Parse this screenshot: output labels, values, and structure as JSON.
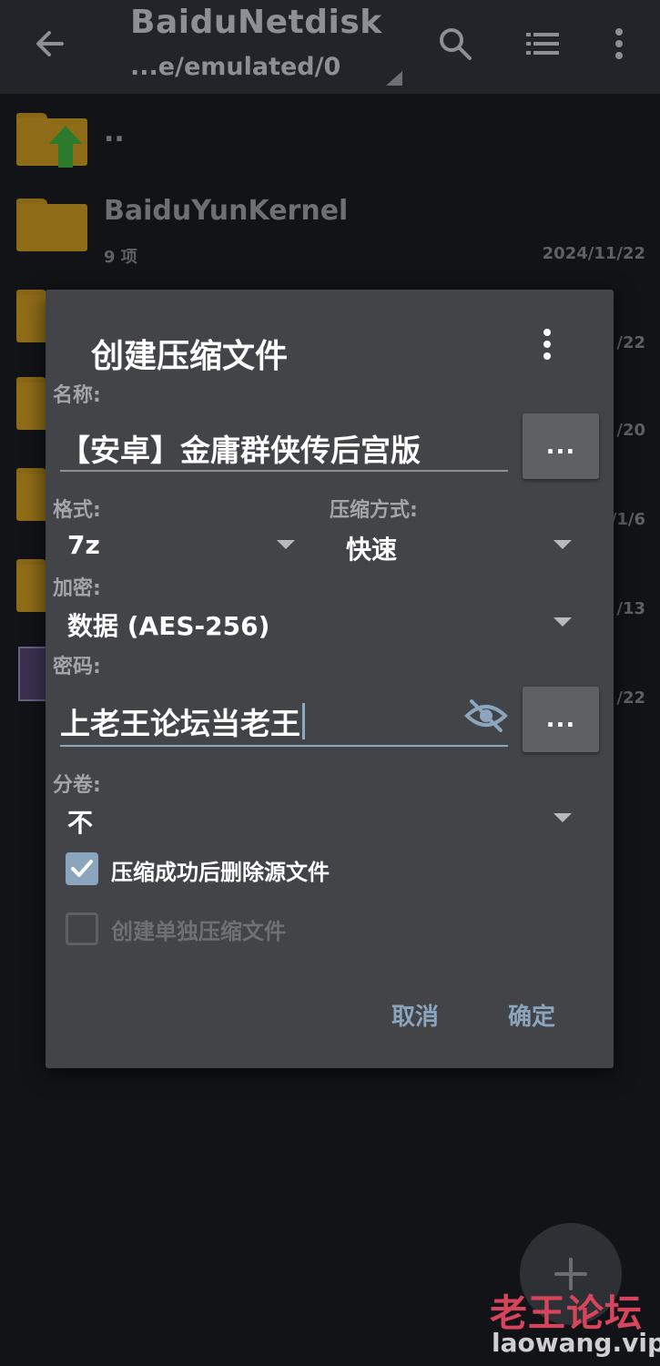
{
  "topbar": {
    "title": "BaiduNetdisk",
    "subtitle": "...e/emulated/0"
  },
  "files": [
    {
      "name": "..",
      "meta": "",
      "date": ""
    },
    {
      "name": "BaiduYunKernel",
      "meta": "9 项",
      "date": "2024/11/22"
    },
    {
      "date": "/22"
    },
    {
      "date": "/20"
    },
    {
      "date": "/1/6"
    },
    {
      "date": "/13"
    },
    {
      "date": "/22"
    }
  ],
  "dialog": {
    "title": "创建压缩文件",
    "name_label": "名称:",
    "name_value": "【安卓】金庸群侠传后宫版",
    "browse_label": "...",
    "format_label": "格式:",
    "format_value": "7z",
    "method_label": "压缩方式:",
    "method_value": "快速",
    "encrypt_label": "加密:",
    "encrypt_value": "数据 (AES-256)",
    "password_label": "密码:",
    "password_value": "上老王论坛当老王",
    "password_more_label": "...",
    "volume_label": "分卷:",
    "volume_value": "不",
    "delete_after_label": "压缩成功后删除源文件",
    "delete_after_checked": true,
    "separate_label": "创建单独压缩文件",
    "separate_checked": false,
    "cancel_label": "取消",
    "ok_label": "确定"
  },
  "watermark": {
    "cn": "老王论坛",
    "url": "laowang.vip"
  },
  "colors": {
    "accent": "#8aa5bd",
    "dialog_bg": "#424447",
    "app_bg": "#111317",
    "folder": "#8f6c17",
    "watermark_red": "#d6455b"
  }
}
